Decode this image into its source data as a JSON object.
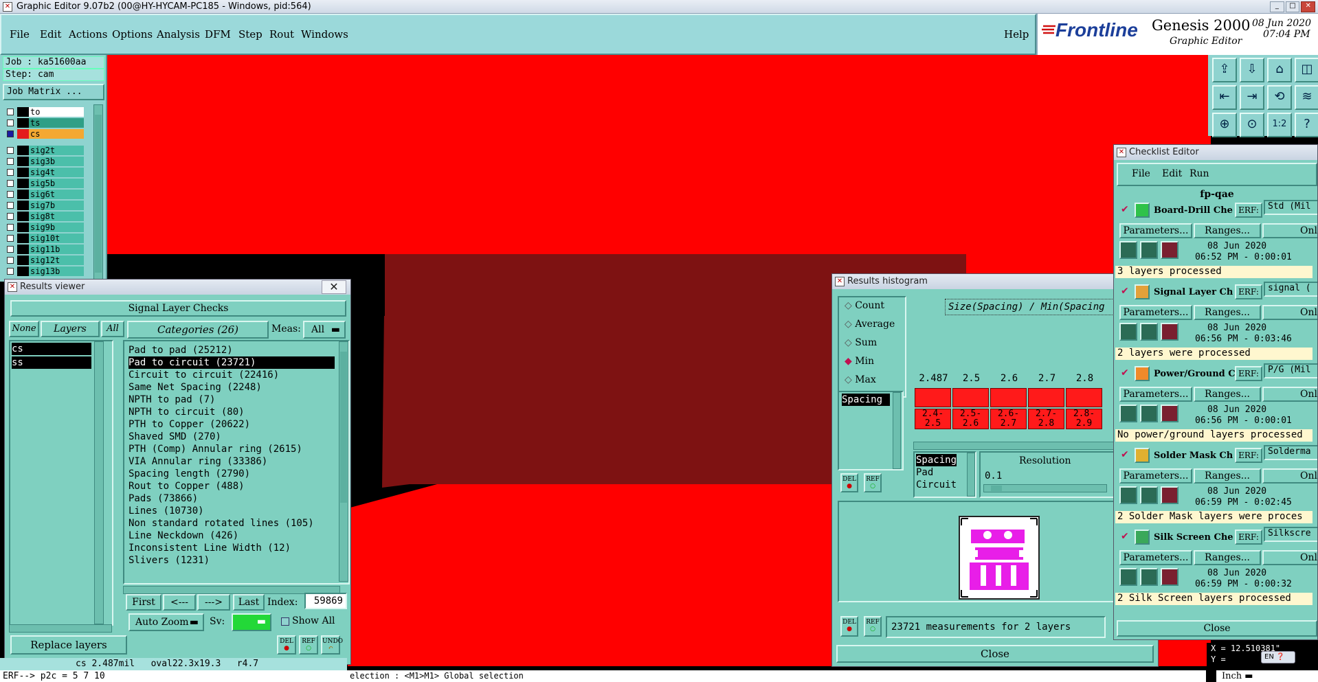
{
  "window": {
    "title": "Graphic Editor 9.07b2 (00@HY-HYCAM-PC185 - Windows, pid:564)"
  },
  "menu": {
    "items": [
      "File",
      "Edit",
      "Actions",
      "Options",
      "Analysis",
      "DFM",
      "Step",
      "Rout",
      "Windows"
    ],
    "help": "Help"
  },
  "brand": {
    "logo": "Frontline",
    "product": "Genesis 2000",
    "subtitle": "Graphic Editor",
    "date": "08 Jun 2020",
    "time": "07:04 PM"
  },
  "job": {
    "job": "Job : ka51600aa",
    "step": "Step: cam",
    "matrix_button": "Job Matrix ..."
  },
  "layers": [
    {
      "name": "to",
      "color": "#ffffff"
    },
    {
      "name": "ts",
      "color": "#2f9f86"
    },
    {
      "name": "cs",
      "color": "#f4a832"
    },
    {
      "name": "sig2t",
      "color": "#4bbfaa"
    },
    {
      "name": "sig3b",
      "color": "#4bbfaa"
    },
    {
      "name": "sig4t",
      "color": "#4bbfaa"
    },
    {
      "name": "sig5b",
      "color": "#4bbfaa"
    },
    {
      "name": "sig6t",
      "color": "#4bbfaa"
    },
    {
      "name": "sig7b",
      "color": "#4bbfaa"
    },
    {
      "name": "sig8t",
      "color": "#4bbfaa"
    },
    {
      "name": "sig9b",
      "color": "#4bbfaa"
    },
    {
      "name": "sig10t",
      "color": "#4bbfaa"
    },
    {
      "name": "sig11b",
      "color": "#4bbfaa"
    },
    {
      "name": "sig12t",
      "color": "#4bbfaa"
    },
    {
      "name": "sig13b",
      "color": "#4bbfaa"
    }
  ],
  "results_viewer": {
    "title": "Results viewer",
    "header": "Signal Layer Checks",
    "none": "None",
    "layers_label": "Layers",
    "all": "All",
    "categories_label": "Categories (26)",
    "meas_label": "Meas:",
    "meas_value": "All",
    "layer_list": [
      "cs",
      "ss"
    ],
    "categories": [
      "Pad to pad (25212)",
      "Pad to circuit (23721)",
      "Circuit to circuit (22416)",
      "Same Net Spacing (2248)",
      "NPTH to pad (7)",
      "NPTH to circuit (80)",
      "PTH to Copper (20622)",
      "Shaved SMD (270)",
      "PTH (Comp) Annular ring (2615)",
      "VIA Annular ring (33386)",
      "Spacing length (2790)",
      "Rout to Copper (488)",
      "Pads (73866)",
      "Lines (10730)",
      "Non standard rotated lines (105)",
      "Line Neckdown (426)",
      "Inconsistent Line Width (12)",
      "Slivers (1231)"
    ],
    "selected_index": 1,
    "first": "First",
    "prev": "<---",
    "next": "--->",
    "last": "Last",
    "index_label": "Index:",
    "index_value": "59869",
    "auto_zoom": "Auto Zoom",
    "sv_label": "Sv:",
    "show_all": "Show All",
    "replace_layers": "Replace layers",
    "del": "DEL",
    "ref": "REF",
    "undo": "UNDO"
  },
  "status": {
    "line1": "cs 2.487mil   oval22.3x19.3   r4.7",
    "line2": "ERF--> p2c = 5 7 10",
    "selection": "election : <M1>M1> Global selection"
  },
  "histogram": {
    "title": "Results histogram",
    "options": [
      "Count",
      "Average",
      "Sum",
      "Min",
      "Max"
    ],
    "selected_option": "Min",
    "heading": "Size(Spacing) / Min(Spacing",
    "type_list": [
      "Spacing"
    ],
    "top_labels": [
      "2.487",
      "2.5",
      "2.6",
      "2.7",
      "2.8"
    ],
    "bins": [
      "2.4-\n2.5",
      "2.5-\n2.6",
      "2.6-\n2.7",
      "2.7-\n2.8",
      "2.8-\n2.9"
    ],
    "sub_list": [
      "Spacing",
      "Pad",
      "Circuit"
    ],
    "resolution_label": "Resolution",
    "resolution_value": "0.1",
    "summary": "23721 measurements for 2 layers",
    "close": "Close"
  },
  "checklist": {
    "title": "Checklist Editor",
    "menu": [
      "File",
      "Edit",
      "Run"
    ],
    "name": "fp-qae",
    "items": [
      {
        "name": "Board-Drill Che",
        "erf": "ERF:",
        "erf_val": "Std (Mil",
        "params": "Parameters...",
        "ranges": "Ranges...",
        "onl": "Onl",
        "date": "08 Jun 2020",
        "time": "06:52 PM - 0:00:01",
        "status": "3 layers processed",
        "icon_color": "#2fc24a"
      },
      {
        "name": "Signal Layer Ch",
        "erf": "ERF:",
        "erf_val": "signal (",
        "params": "Parameters...",
        "ranges": "Ranges...",
        "onl": "Onl",
        "date": "08 Jun 2020",
        "time": "06:56 PM - 0:03:46",
        "status": "2 layers were processed",
        "icon_color": "#e3a13a"
      },
      {
        "name": "Power/Ground C",
        "erf": "ERF:",
        "erf_val": "P/G (Mil",
        "params": "Parameters...",
        "ranges": "Ranges...",
        "onl": "Onl",
        "date": "08 Jun 2020",
        "time": "06:56 PM - 0:00:01",
        "status": "No power/ground layers processed",
        "icon_color": "#f08a2a"
      },
      {
        "name": "Solder Mask Ch",
        "erf": "ERF:",
        "erf_val": "Solderma",
        "params": "Parameters...",
        "ranges": "Ranges...",
        "onl": "Onl",
        "date": "08 Jun 2020",
        "time": "06:59 PM - 0:02:45",
        "status": "2 Solder Mask layers were proces",
        "icon_color": "#e0b030"
      },
      {
        "name": "Silk Screen Che",
        "erf": "ERF:",
        "erf_val": "Silkscre",
        "params": "Parameters...",
        "ranges": "Ranges...",
        "onl": "Onl",
        "date": "08 Jun 2020",
        "time": "06:59 PM - 0:00:32",
        "status": "2 Silk Screen layers processed",
        "icon_color": "#3aa85a"
      }
    ],
    "close": "Close"
  },
  "toolbox": {
    "icons": [
      "⇪",
      "⇩",
      "⌂",
      "◫",
      "⇤",
      "⇥",
      "⟲",
      "≋",
      "⊕",
      "⊙",
      "1:2",
      "?"
    ]
  },
  "coords": {
    "x": "X = 12.510381\"",
    "y": "Y = "
  },
  "units": "Inch",
  "ime": "EN"
}
